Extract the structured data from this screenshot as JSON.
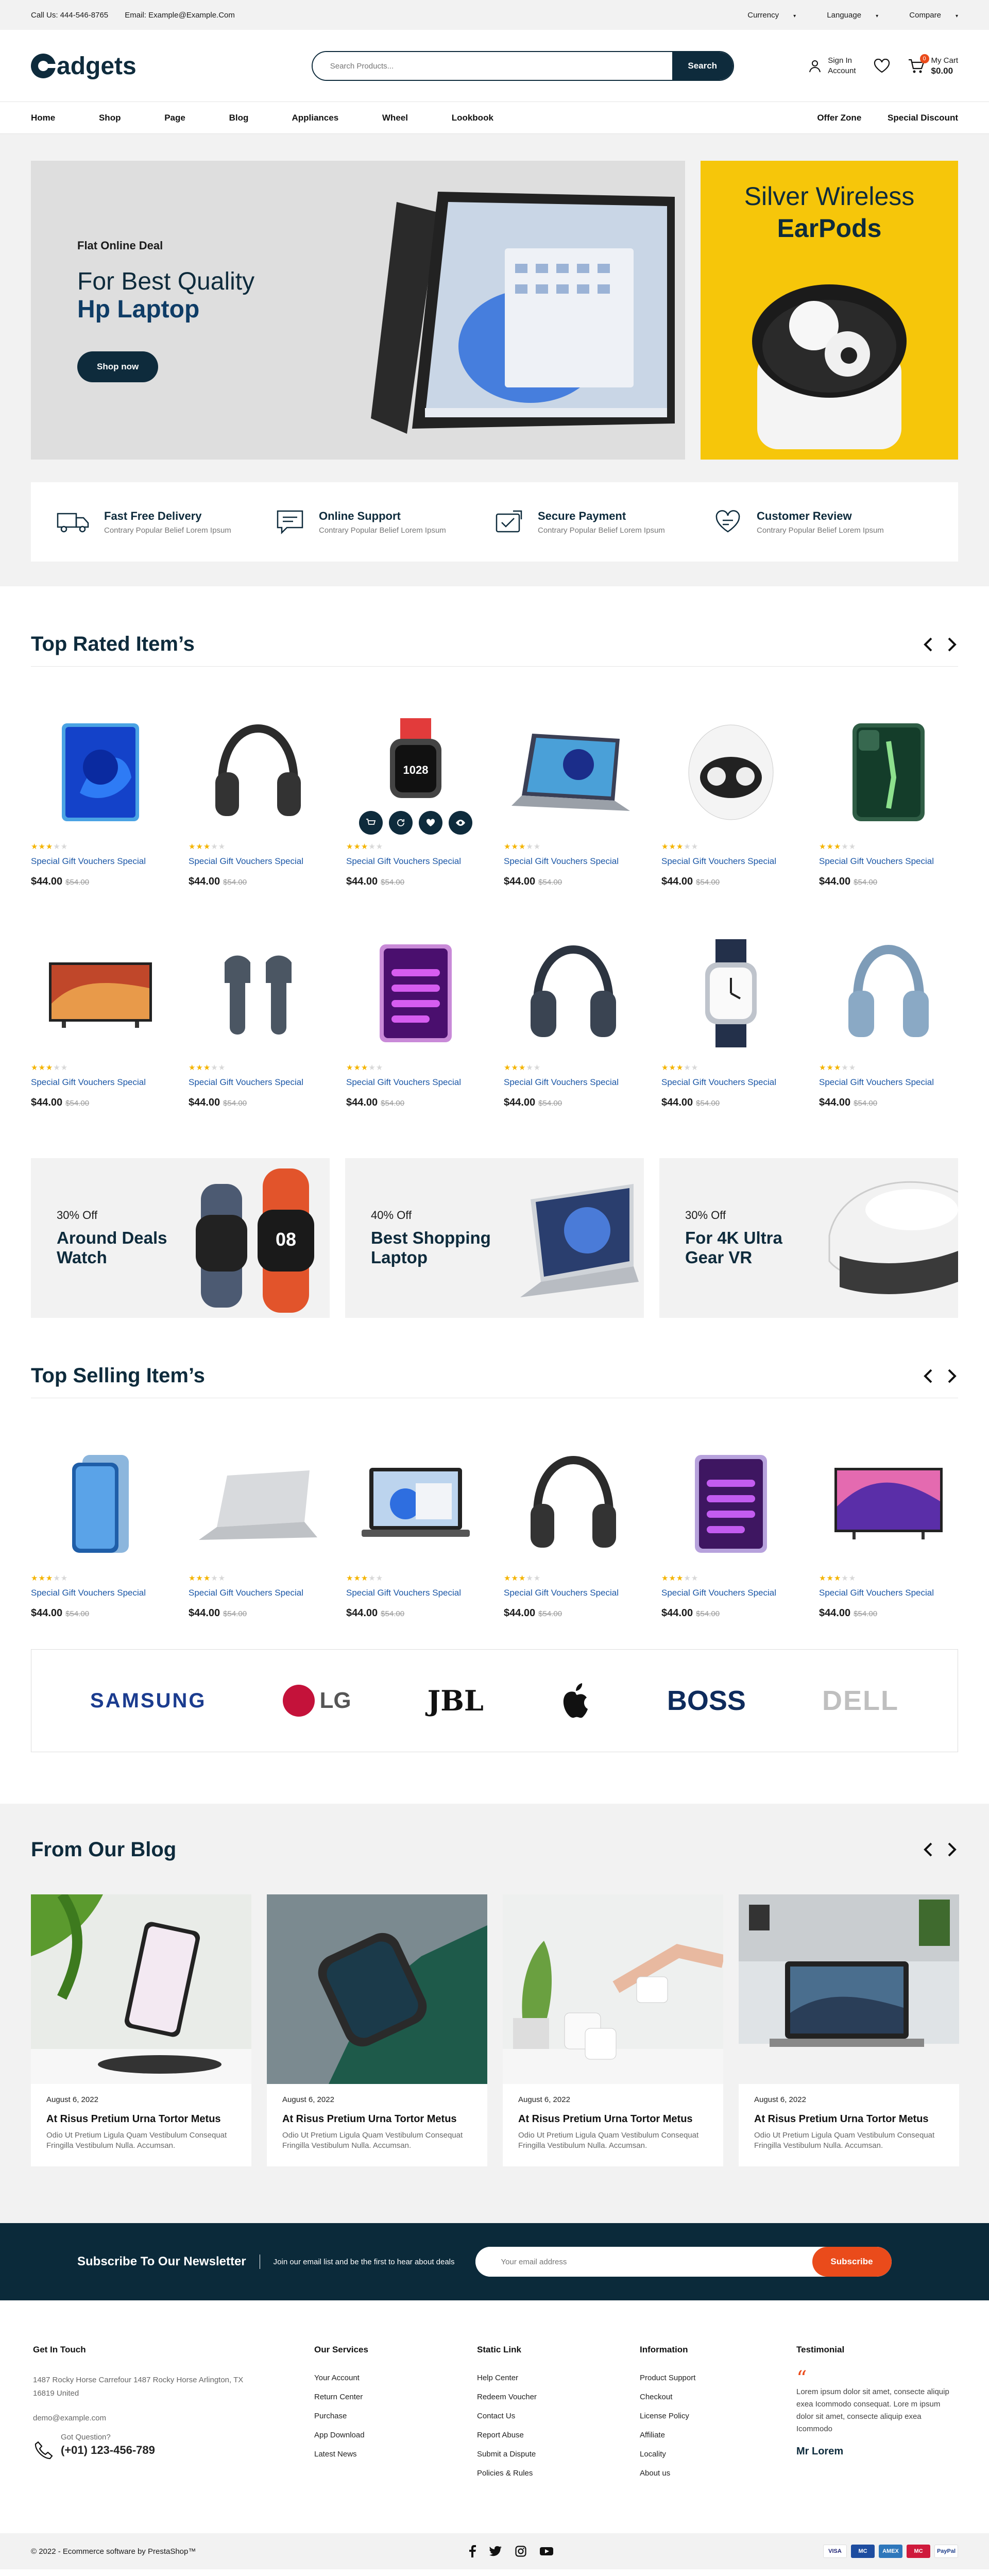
{
  "topbar": {
    "phone": "Call Us: 444-546-8765",
    "email": "Email: Example@Example.Com",
    "currency": "Currency",
    "language": "Language",
    "compare": "Compare"
  },
  "header": {
    "logo_text": "adgets",
    "search_placeholder": "Search Products...",
    "search_button": "Search",
    "signin_line1": "Sign In",
    "signin_line2": "Account",
    "cart_label": "My Cart",
    "cart_total": "$0.00",
    "cart_count": "0"
  },
  "nav": {
    "left": [
      "Home",
      "Shop",
      "Page",
      "Blog",
      "Appliances",
      "Wheel",
      "Lookbook"
    ],
    "right": [
      "Offer Zone",
      "Special Discount"
    ]
  },
  "hero": {
    "deal": "Flat Online Deal",
    "title1": "For Best Quality",
    "title2": "Hp Laptop",
    "button": "Shop now",
    "side_title1": "Silver Wireless",
    "side_title2": "EarPods"
  },
  "features": [
    {
      "title": "Fast Free Delivery",
      "sub": "Contrary Popular Belief Lorem Ipsum",
      "icon": "truck-icon"
    },
    {
      "title": "Online Support",
      "sub": "Contrary Popular Belief Lorem Ipsum",
      "icon": "chat-icon"
    },
    {
      "title": "Secure Payment",
      "sub": "Contrary Popular Belief Lorem Ipsum",
      "icon": "shield-icon"
    },
    {
      "title": "Customer Review",
      "sub": "Contrary Popular Belief Lorem Ipsum",
      "icon": "review-icon"
    }
  ],
  "top_rated": {
    "title": "Top Rated Item’s",
    "product_name": "Special Gift Vouchers Special",
    "price": "$44.00",
    "old_price": "$54.00"
  },
  "banners": [
    {
      "discount": "30% Off",
      "title": "Around Deals Watch"
    },
    {
      "discount": "40% Off",
      "title": "Best Shopping Laptop"
    },
    {
      "discount": "30% Off",
      "title": "For 4K Ultra Gear VR"
    }
  ],
  "top_selling": {
    "title": "Top Selling Item’s"
  },
  "brands": [
    "SAMSUNG",
    "LG",
    "JBL",
    "apple",
    "BOSS",
    "DELL"
  ],
  "blog": {
    "title": "From Our Blog",
    "date": "August 6, 2022",
    "post_title": "At Risus Pretium Urna Tortor Metus",
    "post_text": "Odio Ut Pretium Ligula Quam Vestibulum Consequat Fringilla Vestibulum Nulla. Accumsan."
  },
  "newsletter": {
    "title": "Subscribe To Our Newsletter",
    "sub": "Join our email list and be the first to hear about deals",
    "placeholder": "Your email address",
    "button": "Subscribe"
  },
  "footer": {
    "contact": {
      "title": "Get In Touch",
      "address": "1487 Rocky Horse Carrefour 1487 Rocky Horse Arlington, TX 16819 United",
      "email": "demo@example.com",
      "q": "Got Question?",
      "phone": "(+01) 123-456-789"
    },
    "services": {
      "title": "Our Services",
      "items": [
        "Your Account",
        "Return Center",
        "Purchase",
        "App Download",
        "Latest News"
      ]
    },
    "static": {
      "title": "Static Link",
      "items": [
        "Help Center",
        "Redeem Voucher",
        "Contact Us",
        "Report Abuse",
        "Submit a Dispute",
        "Policies & Rules"
      ]
    },
    "info": {
      "title": "Information",
      "items": [
        "Product Support",
        "Checkout",
        "License Policy",
        "Affiliate",
        "Locality",
        "About us"
      ]
    },
    "testimonial": {
      "title": "Testimonial",
      "text": "Lorem ipsum dolor sit amet, consecte aliquip exea Icommodo consequat. Lore m ipsum dolor sit amet, consecte aliquip exea Icommodo",
      "author": "Mr Lorem"
    },
    "copyright": "© 2022 - Ecommerce software by PrestaShop™",
    "payments": [
      "VISA",
      "MC",
      "AMEX",
      "MC",
      "PayPal"
    ]
  }
}
